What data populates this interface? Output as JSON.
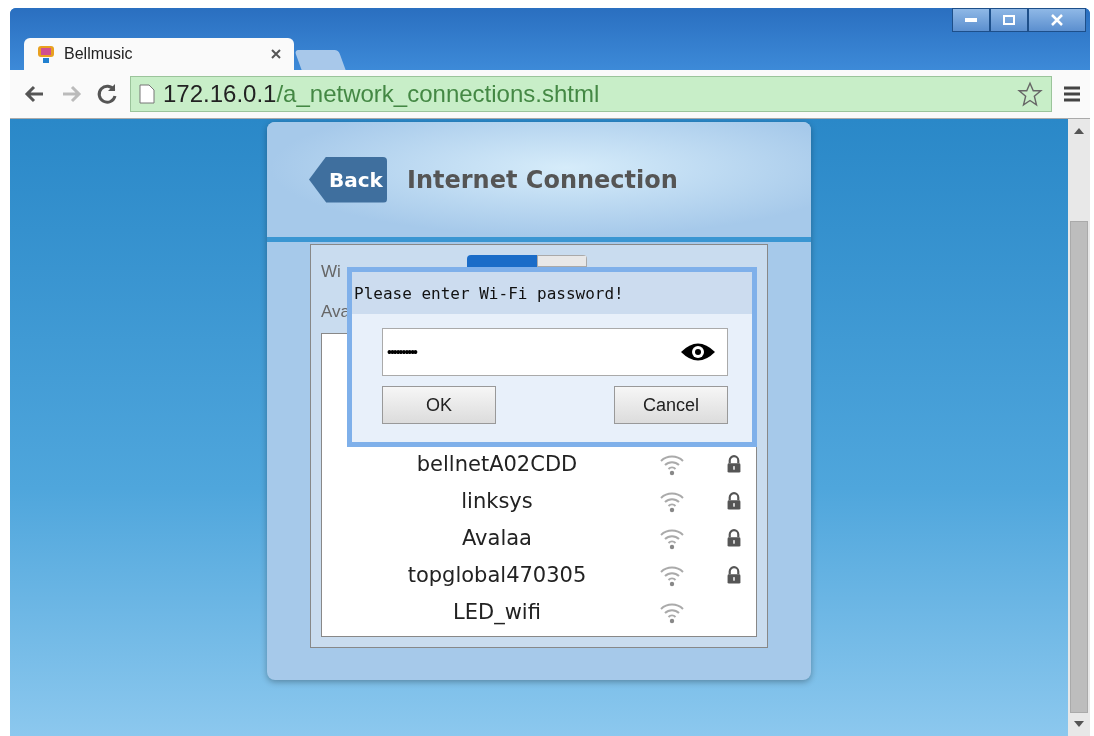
{
  "browser": {
    "tab": {
      "title": "Bellmusic"
    },
    "address": {
      "host": "172.16.0.1",
      "path": "/a_network_connections.shtml"
    }
  },
  "header": {
    "back": "Back",
    "title": "Internet Connection"
  },
  "wireless": {
    "label": "Wi",
    "on": true
  },
  "available": {
    "label": "Ava"
  },
  "networks": [
    {
      "name": "bellnetA02CDD",
      "locked": true
    },
    {
      "name": "linksys",
      "locked": true
    },
    {
      "name": "Avalaa",
      "locked": true
    },
    {
      "name": "topglobal470305",
      "locked": true
    },
    {
      "name": "LED_wifi",
      "locked": false
    }
  ],
  "dialog": {
    "title": "Please enter Wi-Fi password!",
    "value": "••••••••••",
    "buttons": [
      "OK",
      "Cancel"
    ]
  }
}
